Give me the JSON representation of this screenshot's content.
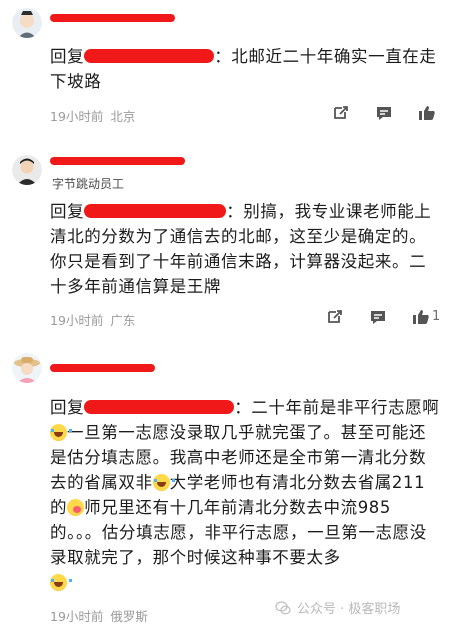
{
  "comments": [
    {
      "reply_prefix": "回复",
      "text_after": "：北邮近二十年确实一直在走下坡路",
      "time": "19小时前",
      "location": "北京",
      "like_count": ""
    },
    {
      "subtitle": "字节跳动员工",
      "reply_prefix": "回复",
      "text_after": "：别搞，我专业课老师能上清北的分数为了通信去的北邮，这至少是确定的。你只是看到了十年前通信末路，计算器没起来。二十多年前通信算是王牌",
      "time": "19小时前",
      "location": "广东",
      "like_count": "1"
    },
    {
      "reply_prefix": "回复",
      "text_seg1": "：二十年前是非平行志愿啊",
      "text_seg2": "一旦第一志愿没录取几乎就完蛋了。甚至可能还是估分填志愿。我高中老师还是全市第一清北分数去的省属双非",
      "text_seg3": "大学老师也有清北分数去省属211的",
      "text_seg4": "师兄里还有十几年前清北分数去中流985的。。。估分填志愿，非平行志愿，一旦第一志愿没录取就完了，那个时候这种事不要太多",
      "time": "19小时前",
      "location": "俄罗斯",
      "like_count": ""
    }
  ],
  "watermark": "公众号 · 极客职场",
  "colors": {
    "redaction": "#f01818",
    "meta": "#9a9a9a"
  }
}
